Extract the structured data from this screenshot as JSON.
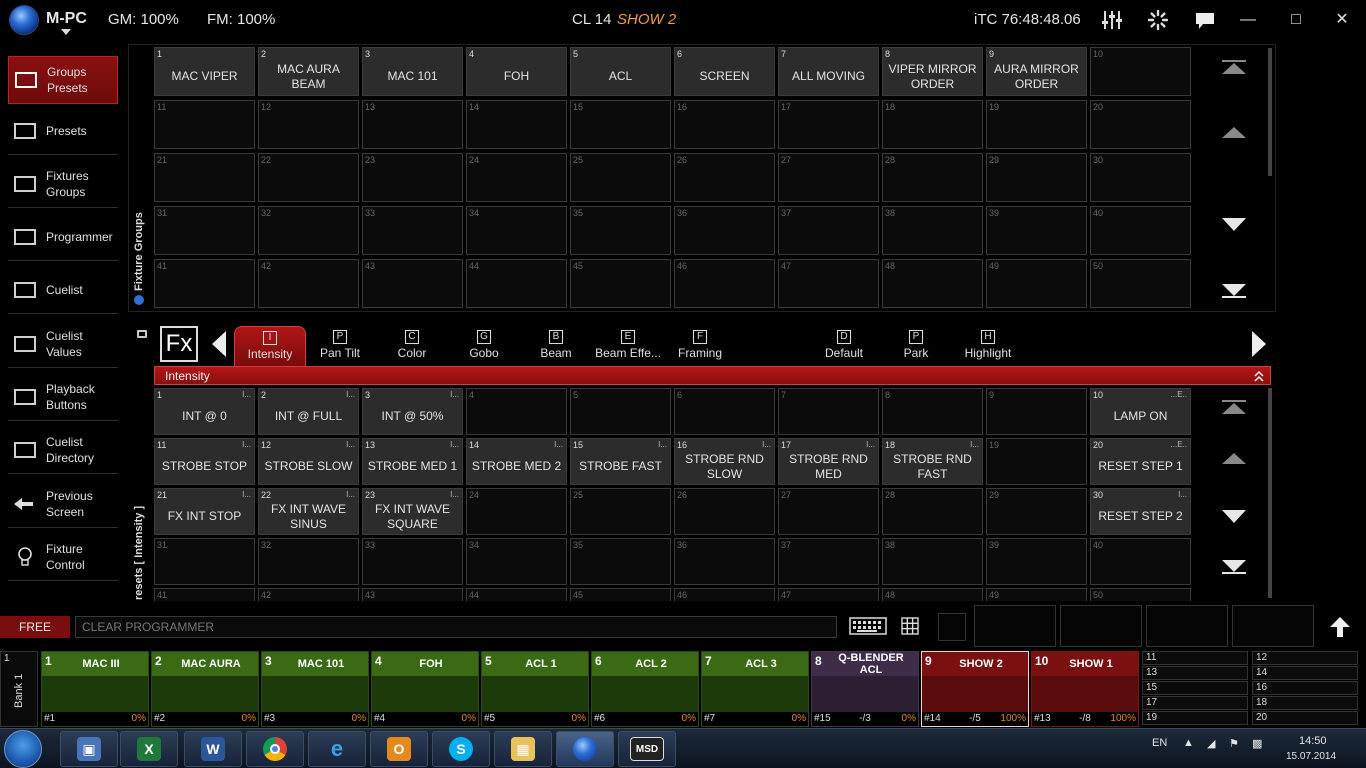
{
  "topbar": {
    "app_name": "M-PC",
    "gm": "GM: 100%",
    "fm": "FM: 100%",
    "cuelist": "CL 14",
    "show": "SHOW 2",
    "timecode": "iTC 76:48:48.06"
  },
  "sidebar": {
    "items": [
      {
        "label": "Groups\nPresets",
        "icon": "square-icon"
      },
      {
        "label": "Presets",
        "icon": "square-icon"
      },
      {
        "label": "Fixtures\nGroups",
        "icon": "square-icon"
      },
      {
        "label": "Programmer",
        "icon": "square-icon"
      },
      {
        "label": "Cuelist",
        "icon": "square-icon"
      },
      {
        "label": "Cuelist\nValues",
        "icon": "square-icon"
      },
      {
        "label": "Playback\nButtons",
        "icon": "square-icon"
      },
      {
        "label": "Cuelist\nDirectory",
        "icon": "square-icon"
      },
      {
        "label": "Previous\nScreen",
        "icon": "arrow-left-icon"
      },
      {
        "label": "Fixture\nControl",
        "icon": "bulb-icon"
      }
    ]
  },
  "fixture_groups": {
    "label": "Fixture Groups",
    "cells": [
      {
        "n": "1",
        "t": "MAC VIPER"
      },
      {
        "n": "2",
        "t": "MAC AURA\nBEAM"
      },
      {
        "n": "3",
        "t": "MAC 101"
      },
      {
        "n": "4",
        "t": "FOH"
      },
      {
        "n": "5",
        "t": "ACL"
      },
      {
        "n": "6",
        "t": "SCREEN"
      },
      {
        "n": "7",
        "t": "ALL MOVING"
      },
      {
        "n": "8",
        "t": "VIPER MIRROR\nORDER"
      },
      {
        "n": "9",
        "t": "AURA MIRROR\nORDER"
      },
      {
        "n": "10",
        "t": ""
      }
    ]
  },
  "tabs": [
    {
      "key": "I",
      "label": "Intensity"
    },
    {
      "key": "P",
      "label": "Pan Tilt"
    },
    {
      "key": "C",
      "label": "Color"
    },
    {
      "key": "G",
      "label": "Gobo"
    },
    {
      "key": "B",
      "label": "Beam"
    },
    {
      "key": "E",
      "label": "Beam Effe..."
    },
    {
      "key": "F",
      "label": "Framing"
    },
    {
      "key": "D",
      "label": "Default"
    },
    {
      "key": "P",
      "label": "Park"
    },
    {
      "key": "H",
      "label": "Highlight"
    }
  ],
  "fx_label": "Fx",
  "section_title": "Intensity",
  "presets": {
    "label": "resets [ Intensity ]",
    "cells": {
      "1": {
        "t": "INT @ 0",
        "tag": "I..."
      },
      "2": {
        "t": "INT @ FULL",
        "tag": "I..."
      },
      "3": {
        "t": "INT @ 50%",
        "tag": "I..."
      },
      "10": {
        "t": "LAMP ON",
        "tag": "...E.."
      },
      "11": {
        "t": "STROBE STOP",
        "tag": "I..."
      },
      "12": {
        "t": "STROBE SLOW",
        "tag": "I..."
      },
      "13": {
        "t": "STROBE MED 1",
        "tag": "I..."
      },
      "14": {
        "t": "STROBE MED 2",
        "tag": "I..."
      },
      "15": {
        "t": "STROBE FAST",
        "tag": "I..."
      },
      "16": {
        "t": "STROBE RND\nSLOW",
        "tag": "I..."
      },
      "17": {
        "t": "STROBE RND\nMED",
        "tag": "I..."
      },
      "18": {
        "t": "STROBE RND\nFAST",
        "tag": "I..."
      },
      "20": {
        "t": "RESET STEP 1",
        "tag": "...E.."
      },
      "21": {
        "t": "FX INT STOP",
        "tag": "I..."
      },
      "22": {
        "t": "FX INT WAVE\nSINUS",
        "tag": "I..."
      },
      "23": {
        "t": "FX INT WAVE\nSQUARE",
        "tag": "I..."
      },
      "30": {
        "t": "RESET STEP 2",
        "tag": "I..."
      }
    }
  },
  "command": {
    "free_label": "FREE",
    "placeholder": "CLEAR PROGRAMMER"
  },
  "bank": {
    "label": "Bank 1",
    "bank_num": "1",
    "playbacks": [
      {
        "n": "1",
        "t": "MAC III",
        "a": "#1",
        "m": "",
        "b": "0%",
        "style": "green"
      },
      {
        "n": "2",
        "t": "MAC AURA",
        "a": "#2",
        "m": "",
        "b": "0%",
        "style": "green"
      },
      {
        "n": "3",
        "t": "MAC 101",
        "a": "#3",
        "m": "",
        "b": "0%",
        "style": "green"
      },
      {
        "n": "4",
        "t": "FOH",
        "a": "#4",
        "m": "",
        "b": "0%",
        "style": "green"
      },
      {
        "n": "5",
        "t": "ACL 1",
        "a": "#5",
        "m": "",
        "b": "0%",
        "style": "green"
      },
      {
        "n": "6",
        "t": "ACL 2",
        "a": "#6",
        "m": "",
        "b": "0%",
        "style": "green"
      },
      {
        "n": "7",
        "t": "ACL 3",
        "a": "#7",
        "m": "",
        "b": "0%",
        "style": "green"
      },
      {
        "n": "8",
        "t": "Q-BLENDER\nACL",
        "a": "#15",
        "m": "-/3",
        "b": "0%",
        "style": "purple"
      },
      {
        "n": "9",
        "t": "SHOW 2",
        "a": "#14",
        "m": "-/5",
        "b": "100%",
        "style": "red sel"
      },
      {
        "n": "10",
        "t": "SHOW 1",
        "a": "#13",
        "m": "-/8",
        "b": "100%",
        "style": "red"
      }
    ],
    "mini": [
      "11",
      "12",
      "13",
      "14",
      "15",
      "16",
      "17",
      "18",
      "19",
      "20"
    ]
  },
  "taskbar": {
    "lang": "EN",
    "time": "14:50",
    "date": "15.07.2014",
    "apps": [
      "computer-icon",
      "excel-icon",
      "word-icon",
      "chrome-icon",
      "ie-icon",
      "outlook-icon",
      "skype-icon",
      "explorer-icon",
      "mpc-icon",
      "msd-icon"
    ]
  },
  "colors": {
    "accent_red": "#b41616",
    "playback_green": "#3a6a14",
    "show_orange": "#f0a030"
  }
}
